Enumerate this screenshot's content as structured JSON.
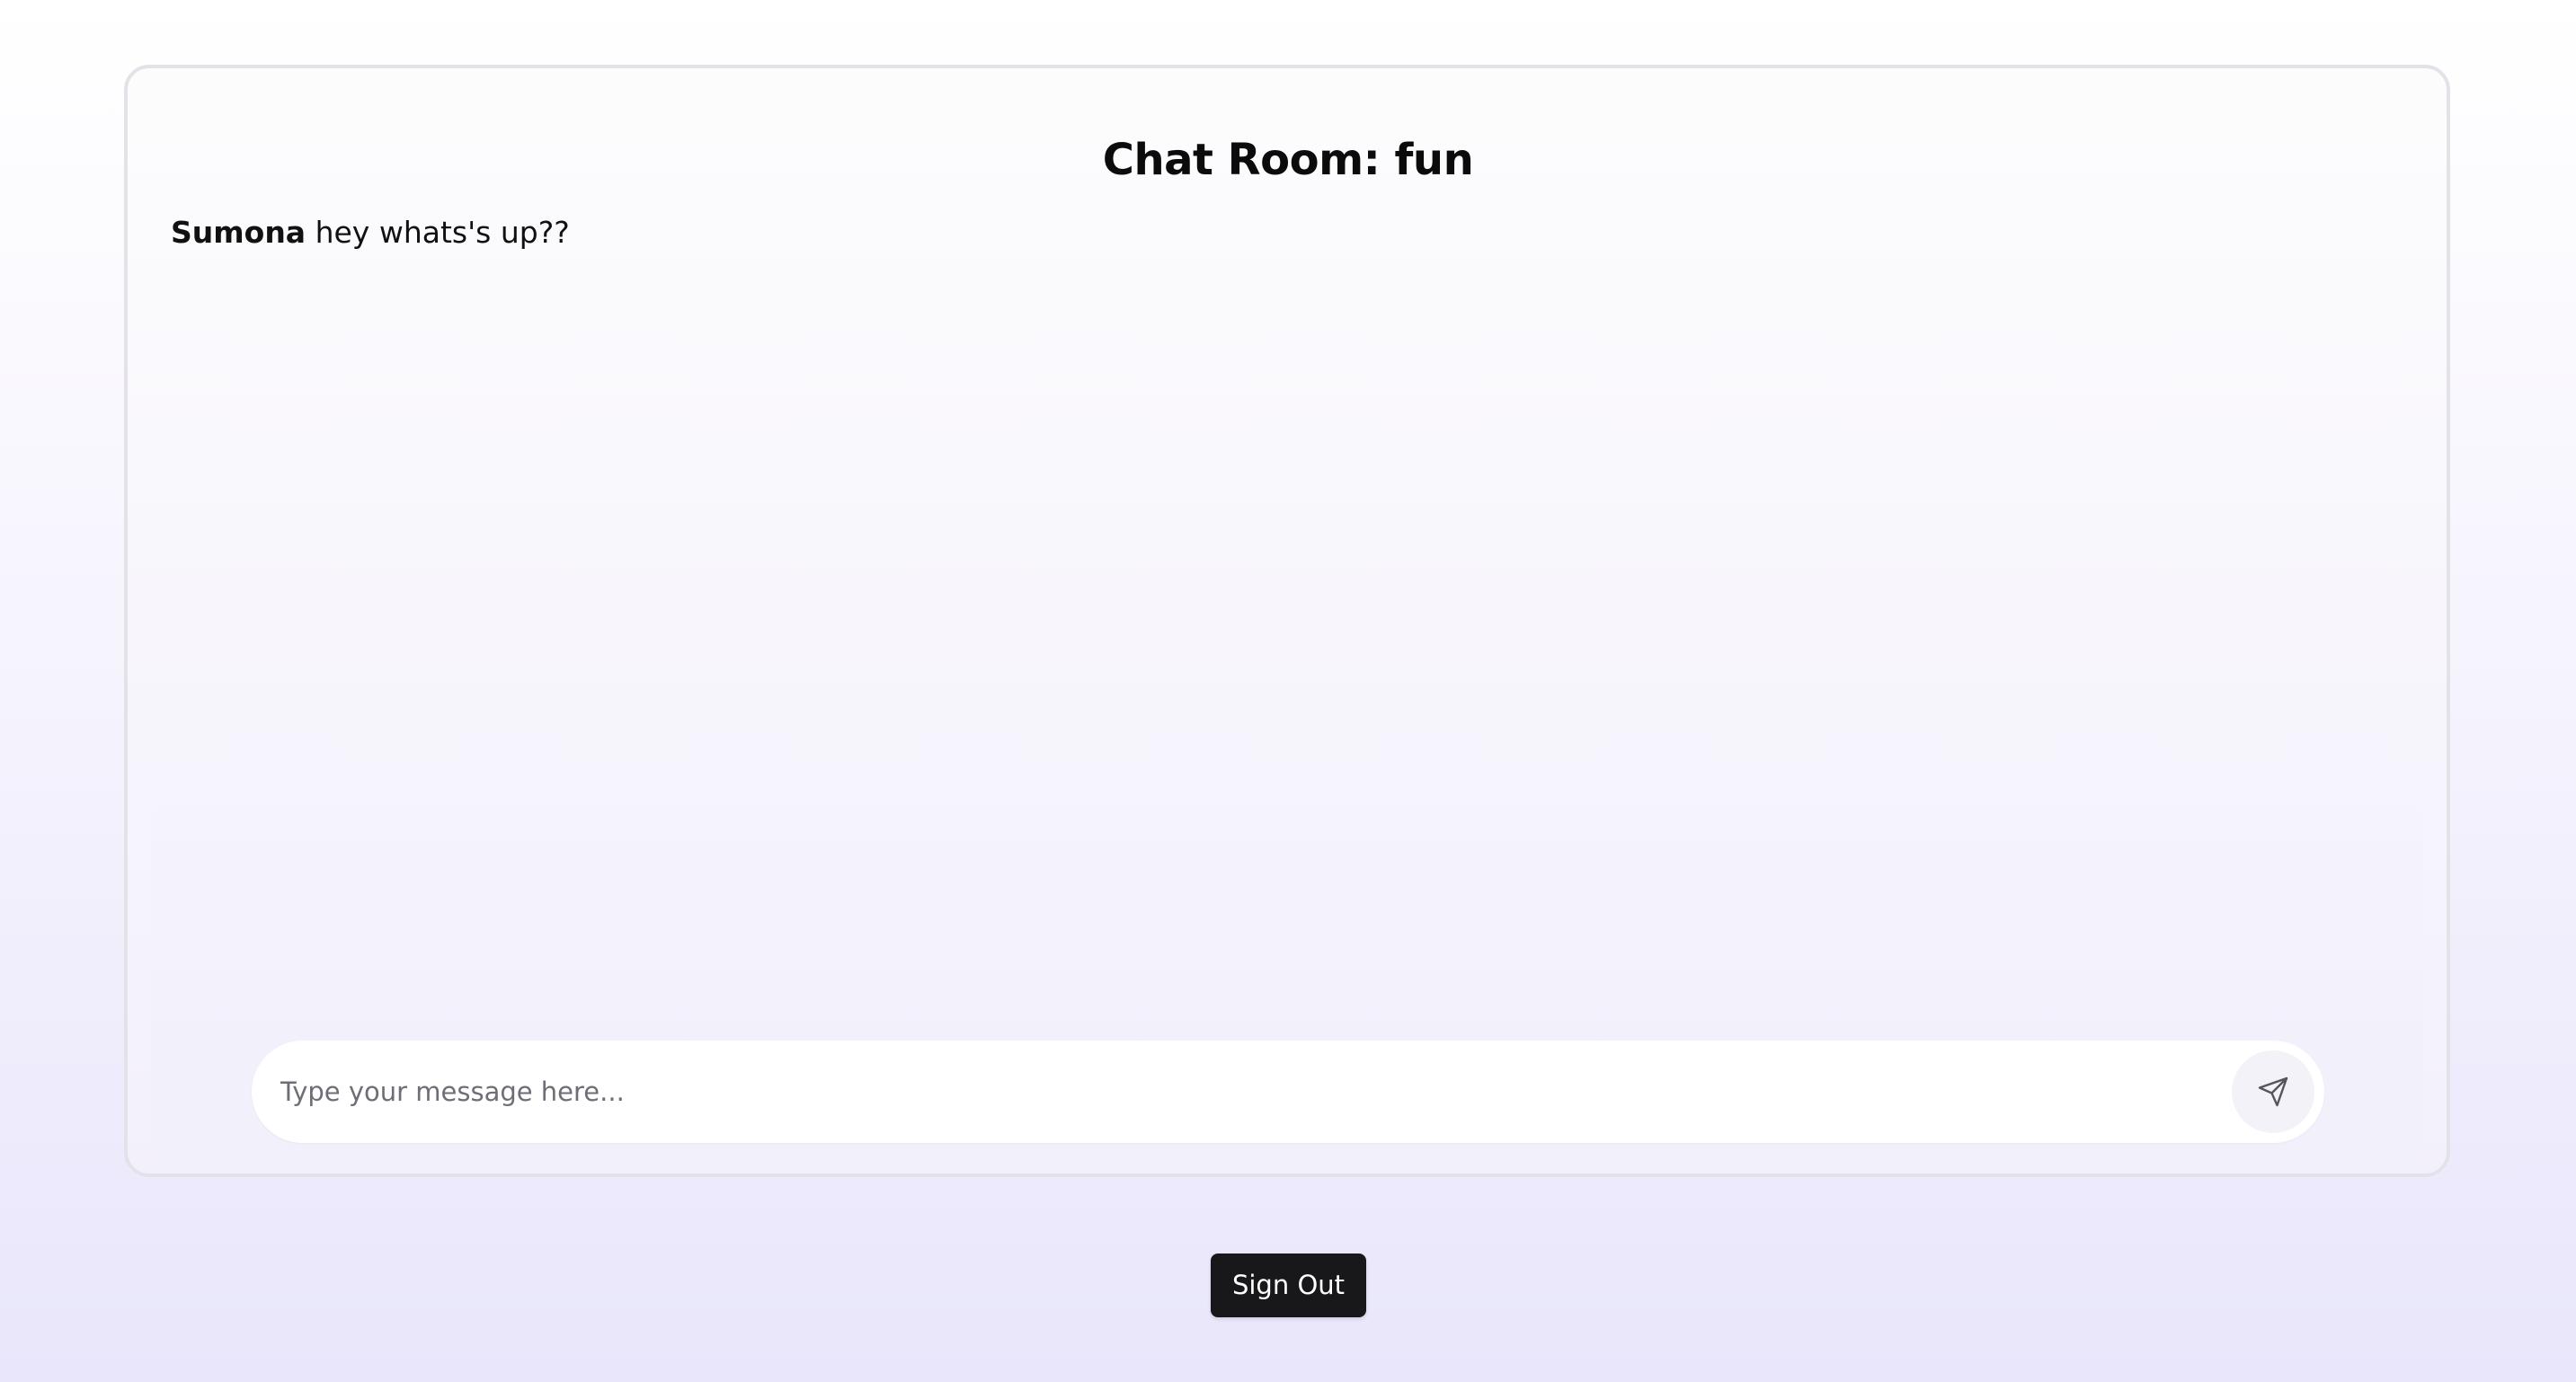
{
  "chat": {
    "title": "Chat Room: fun",
    "messages": [
      {
        "sender": "Sumona",
        "text": "hey whats's up??"
      }
    ]
  },
  "composer": {
    "placeholder": "Type your message here...",
    "value": "",
    "send_icon": "send-icon"
  },
  "sign_out": {
    "label": "Sign Out"
  },
  "colors": {
    "primary_button": "#18181b",
    "page_bg_top": "#ffffff",
    "page_bg_bottom": "#e9e6fb"
  }
}
